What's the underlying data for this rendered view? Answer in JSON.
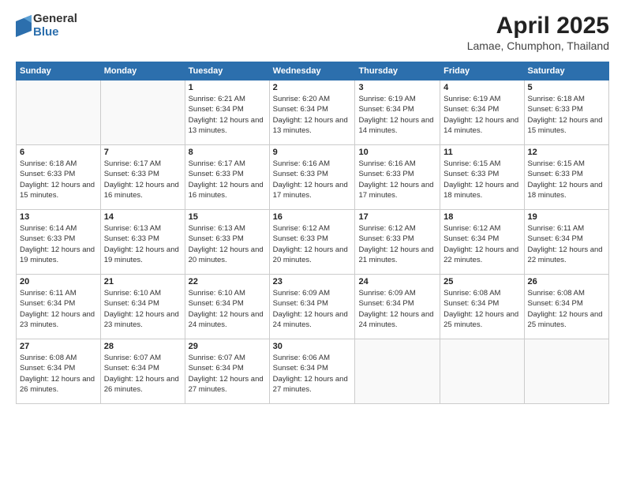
{
  "logo": {
    "general": "General",
    "blue": "Blue"
  },
  "title": "April 2025",
  "location": "Lamae, Chumphon, Thailand",
  "weekdays": [
    "Sunday",
    "Monday",
    "Tuesday",
    "Wednesday",
    "Thursday",
    "Friday",
    "Saturday"
  ],
  "weeks": [
    [
      {
        "day": "",
        "sunrise": "",
        "sunset": "",
        "daylight": ""
      },
      {
        "day": "",
        "sunrise": "",
        "sunset": "",
        "daylight": ""
      },
      {
        "day": "1",
        "sunrise": "Sunrise: 6:21 AM",
        "sunset": "Sunset: 6:34 PM",
        "daylight": "Daylight: 12 hours and 13 minutes."
      },
      {
        "day": "2",
        "sunrise": "Sunrise: 6:20 AM",
        "sunset": "Sunset: 6:34 PM",
        "daylight": "Daylight: 12 hours and 13 minutes."
      },
      {
        "day": "3",
        "sunrise": "Sunrise: 6:19 AM",
        "sunset": "Sunset: 6:34 PM",
        "daylight": "Daylight: 12 hours and 14 minutes."
      },
      {
        "day": "4",
        "sunrise": "Sunrise: 6:19 AM",
        "sunset": "Sunset: 6:34 PM",
        "daylight": "Daylight: 12 hours and 14 minutes."
      },
      {
        "day": "5",
        "sunrise": "Sunrise: 6:18 AM",
        "sunset": "Sunset: 6:33 PM",
        "daylight": "Daylight: 12 hours and 15 minutes."
      }
    ],
    [
      {
        "day": "6",
        "sunrise": "Sunrise: 6:18 AM",
        "sunset": "Sunset: 6:33 PM",
        "daylight": "Daylight: 12 hours and 15 minutes."
      },
      {
        "day": "7",
        "sunrise": "Sunrise: 6:17 AM",
        "sunset": "Sunset: 6:33 PM",
        "daylight": "Daylight: 12 hours and 16 minutes."
      },
      {
        "day": "8",
        "sunrise": "Sunrise: 6:17 AM",
        "sunset": "Sunset: 6:33 PM",
        "daylight": "Daylight: 12 hours and 16 minutes."
      },
      {
        "day": "9",
        "sunrise": "Sunrise: 6:16 AM",
        "sunset": "Sunset: 6:33 PM",
        "daylight": "Daylight: 12 hours and 17 minutes."
      },
      {
        "day": "10",
        "sunrise": "Sunrise: 6:16 AM",
        "sunset": "Sunset: 6:33 PM",
        "daylight": "Daylight: 12 hours and 17 minutes."
      },
      {
        "day": "11",
        "sunrise": "Sunrise: 6:15 AM",
        "sunset": "Sunset: 6:33 PM",
        "daylight": "Daylight: 12 hours and 18 minutes."
      },
      {
        "day": "12",
        "sunrise": "Sunrise: 6:15 AM",
        "sunset": "Sunset: 6:33 PM",
        "daylight": "Daylight: 12 hours and 18 minutes."
      }
    ],
    [
      {
        "day": "13",
        "sunrise": "Sunrise: 6:14 AM",
        "sunset": "Sunset: 6:33 PM",
        "daylight": "Daylight: 12 hours and 19 minutes."
      },
      {
        "day": "14",
        "sunrise": "Sunrise: 6:13 AM",
        "sunset": "Sunset: 6:33 PM",
        "daylight": "Daylight: 12 hours and 19 minutes."
      },
      {
        "day": "15",
        "sunrise": "Sunrise: 6:13 AM",
        "sunset": "Sunset: 6:33 PM",
        "daylight": "Daylight: 12 hours and 20 minutes."
      },
      {
        "day": "16",
        "sunrise": "Sunrise: 6:12 AM",
        "sunset": "Sunset: 6:33 PM",
        "daylight": "Daylight: 12 hours and 20 minutes."
      },
      {
        "day": "17",
        "sunrise": "Sunrise: 6:12 AM",
        "sunset": "Sunset: 6:33 PM",
        "daylight": "Daylight: 12 hours and 21 minutes."
      },
      {
        "day": "18",
        "sunrise": "Sunrise: 6:12 AM",
        "sunset": "Sunset: 6:34 PM",
        "daylight": "Daylight: 12 hours and 22 minutes."
      },
      {
        "day": "19",
        "sunrise": "Sunrise: 6:11 AM",
        "sunset": "Sunset: 6:34 PM",
        "daylight": "Daylight: 12 hours and 22 minutes."
      }
    ],
    [
      {
        "day": "20",
        "sunrise": "Sunrise: 6:11 AM",
        "sunset": "Sunset: 6:34 PM",
        "daylight": "Daylight: 12 hours and 23 minutes."
      },
      {
        "day": "21",
        "sunrise": "Sunrise: 6:10 AM",
        "sunset": "Sunset: 6:34 PM",
        "daylight": "Daylight: 12 hours and 23 minutes."
      },
      {
        "day": "22",
        "sunrise": "Sunrise: 6:10 AM",
        "sunset": "Sunset: 6:34 PM",
        "daylight": "Daylight: 12 hours and 24 minutes."
      },
      {
        "day": "23",
        "sunrise": "Sunrise: 6:09 AM",
        "sunset": "Sunset: 6:34 PM",
        "daylight": "Daylight: 12 hours and 24 minutes."
      },
      {
        "day": "24",
        "sunrise": "Sunrise: 6:09 AM",
        "sunset": "Sunset: 6:34 PM",
        "daylight": "Daylight: 12 hours and 24 minutes."
      },
      {
        "day": "25",
        "sunrise": "Sunrise: 6:08 AM",
        "sunset": "Sunset: 6:34 PM",
        "daylight": "Daylight: 12 hours and 25 minutes."
      },
      {
        "day": "26",
        "sunrise": "Sunrise: 6:08 AM",
        "sunset": "Sunset: 6:34 PM",
        "daylight": "Daylight: 12 hours and 25 minutes."
      }
    ],
    [
      {
        "day": "27",
        "sunrise": "Sunrise: 6:08 AM",
        "sunset": "Sunset: 6:34 PM",
        "daylight": "Daylight: 12 hours and 26 minutes."
      },
      {
        "day": "28",
        "sunrise": "Sunrise: 6:07 AM",
        "sunset": "Sunset: 6:34 PM",
        "daylight": "Daylight: 12 hours and 26 minutes."
      },
      {
        "day": "29",
        "sunrise": "Sunrise: 6:07 AM",
        "sunset": "Sunset: 6:34 PM",
        "daylight": "Daylight: 12 hours and 27 minutes."
      },
      {
        "day": "30",
        "sunrise": "Sunrise: 6:06 AM",
        "sunset": "Sunset: 6:34 PM",
        "daylight": "Daylight: 12 hours and 27 minutes."
      },
      {
        "day": "",
        "sunrise": "",
        "sunset": "",
        "daylight": ""
      },
      {
        "day": "",
        "sunrise": "",
        "sunset": "",
        "daylight": ""
      },
      {
        "day": "",
        "sunrise": "",
        "sunset": "",
        "daylight": ""
      }
    ]
  ]
}
